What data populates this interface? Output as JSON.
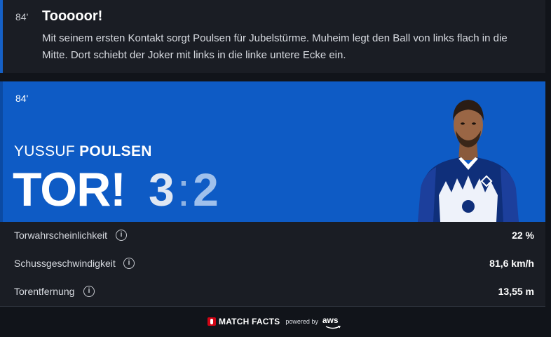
{
  "ticker": {
    "minute": "84'",
    "title": "Tooooor!",
    "text": "Mit seinem ersten Kontakt sorgt Poulsen für Jubelstürme. Muheim legt den Ball von links flach in die Mitte. Dort schiebt der Joker mit links in die linke untere Ecke ein."
  },
  "goal_card": {
    "minute": "84'",
    "player_first": "YUSSUF",
    "player_last": "POULSEN",
    "headline": "TOR!",
    "score_home": "3",
    "score_sep": ":",
    "score_away": "2",
    "colors": {
      "hero_bg": "#0e5bc5",
      "card_bg": "#1a1d24"
    }
  },
  "stats": [
    {
      "label": "Torwahrscheinlichkeit",
      "value": "22 %",
      "icon": "info-icon"
    },
    {
      "label": "Schussgeschwindigkeit",
      "value": "81,6 km/h",
      "icon": "info-icon"
    },
    {
      "label": "Torentfernung",
      "value": "13,55 m",
      "icon": "info-icon"
    }
  ],
  "footer": {
    "brand": "MATCH FACTS",
    "powered_by": "powered by",
    "partner": "aws"
  }
}
